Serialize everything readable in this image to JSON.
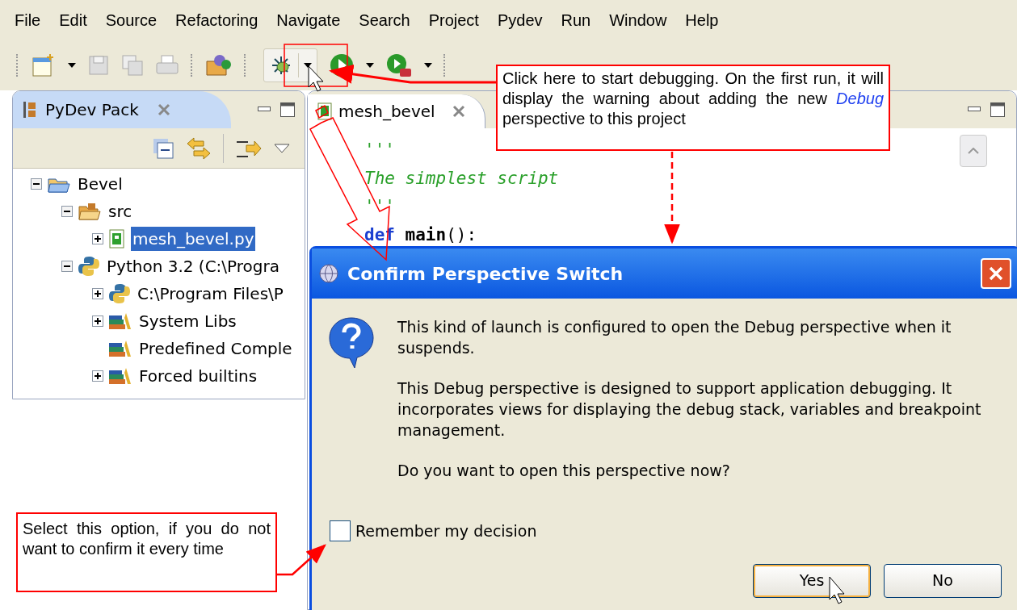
{
  "menu_bar": [
    "File",
    "Edit",
    "Source",
    "Refactoring",
    "Navigate",
    "Search",
    "Project",
    "Pydev",
    "Run",
    "Window",
    "Help"
  ],
  "explorer": {
    "title": "PyDev Pack",
    "tree": [
      {
        "label": "Bevel",
        "kind": "project",
        "expandable": true,
        "expanded": true,
        "selected": false,
        "children": [
          {
            "label": "src",
            "kind": "package",
            "expandable": true,
            "expanded": true,
            "selected": false,
            "children": [
              {
                "label": "mesh_bevel.py",
                "kind": "file",
                "expandable": true,
                "expanded": false,
                "selected": true
              }
            ]
          },
          {
            "label": "Python 3.2  (C:\\Progra",
            "kind": "python",
            "expandable": true,
            "expanded": true,
            "selected": false,
            "children": [
              {
                "label": "C:\\Program Files\\P",
                "kind": "python",
                "expandable": true,
                "expanded": false,
                "selected": false
              },
              {
                "label": "System Libs",
                "kind": "library",
                "expandable": true,
                "expanded": false,
                "selected": false
              },
              {
                "label": "Predefined Comple",
                "kind": "library",
                "expandable": false,
                "selected": false
              },
              {
                "label": "Forced builtins",
                "kind": "library",
                "expandable": true,
                "expanded": false,
                "selected": false
              }
            ]
          }
        ]
      }
    ]
  },
  "editor": {
    "tab": "mesh_bevel",
    "code": [
      [
        {
          "kind": "string",
          "text": "'''"
        }
      ],
      [
        {
          "kind": "string",
          "text": "The simplest script"
        }
      ],
      [
        {
          "kind": "string",
          "text": "'''"
        }
      ],
      [
        {
          "kind": "keyword",
          "text": "def "
        },
        {
          "kind": "name",
          "text": "main"
        },
        {
          "kind": "plain",
          "text": "():"
        }
      ]
    ]
  },
  "dialog": {
    "title": "Confirm Perspective Switch",
    "message": [
      "This kind of launch is configured to open the Debug perspective when it suspends.",
      "This Debug perspective is designed to support application debugging.  It incorporates views for displaying the debug stack, variables and breakpoint management.",
      "Do you want to open this perspective now?"
    ],
    "checkbox": {
      "label": "Remember my decision",
      "checked": false
    },
    "buttons": [
      {
        "label": "Yes",
        "default": true
      },
      {
        "label": "No",
        "default": false
      }
    ]
  },
  "callouts": [
    {
      "text": "Click here to start debugging. On the first run, it will display the warning about adding the new *Debug* perspective to this project"
    },
    {
      "text": "Select this option, if you do not want to confirm it every time"
    }
  ]
}
